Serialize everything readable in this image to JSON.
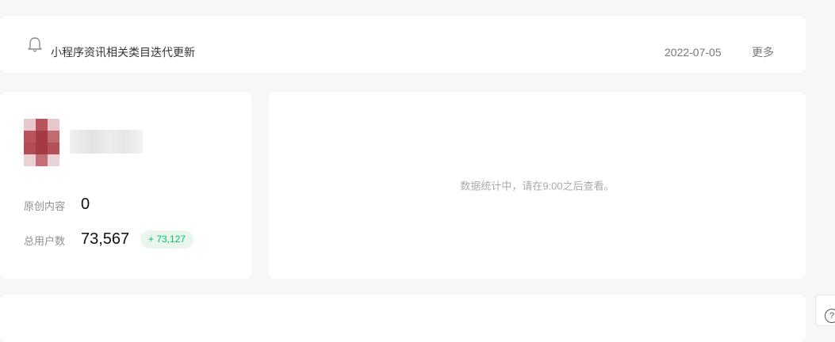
{
  "notice": {
    "icon": "bell-icon",
    "text": "小程序资讯相关类目迭代更新",
    "date": "2022-07-05",
    "more_label": "更多"
  },
  "account": {
    "stats": [
      {
        "label": "原创内容",
        "value": "0"
      },
      {
        "label": "总用户数",
        "value": "73,567",
        "badge": "+ 73,127"
      }
    ]
  },
  "data_panel": {
    "message": "数据统计中，请在9:00之后查看。"
  },
  "help": {
    "icon": "help-icon",
    "glyph": "?"
  },
  "colors": {
    "accent_green": "#07c160",
    "badge_bg": "#e8f6ed",
    "page_bg": "#f6f7f8"
  }
}
